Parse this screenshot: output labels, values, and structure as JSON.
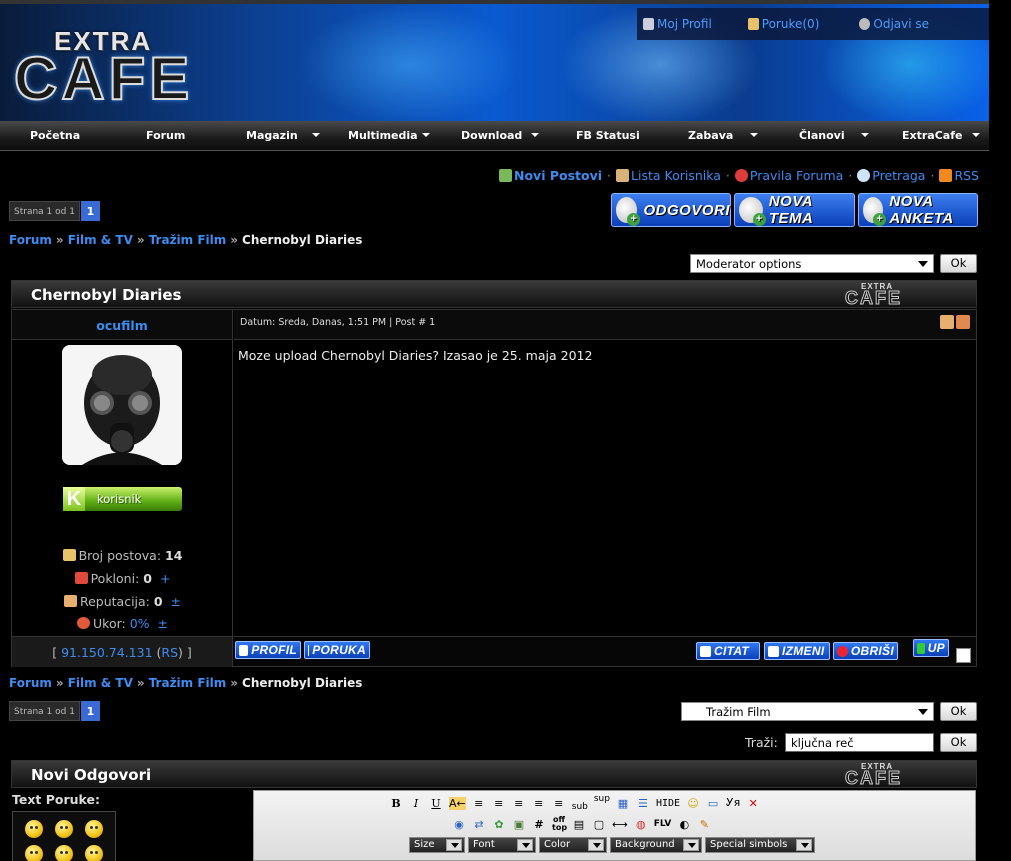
{
  "header": {
    "logo_top": "EXTRA",
    "logo_main": "CAFE",
    "user_links": [
      {
        "label": "Moj Profil",
        "icon": "user-icon"
      },
      {
        "label": "Poruke(0)",
        "icon": "pencil-icon"
      },
      {
        "label": "Odjavi se",
        "icon": "logout-icon"
      }
    ]
  },
  "nav": [
    {
      "label": "Početna",
      "dropdown": false
    },
    {
      "label": "Forum",
      "dropdown": false
    },
    {
      "label": "Magazin",
      "dropdown": true
    },
    {
      "label": "Multimedia",
      "dropdown": true
    },
    {
      "label": "Download",
      "dropdown": true
    },
    {
      "label": "FB Statusi",
      "dropdown": false
    },
    {
      "label": "Zabava",
      "dropdown": true
    },
    {
      "label": "Članovi",
      "dropdown": true
    },
    {
      "label": "ExtraCafe",
      "dropdown": true
    }
  ],
  "quick_links": [
    {
      "label": "Novi Postovi",
      "bold": true,
      "icon": "new-posts-icon"
    },
    {
      "label": "Lista Korisnika",
      "bold": false,
      "icon": "members-icon"
    },
    {
      "label": "Pravila Foruma",
      "bold": false,
      "icon": "rules-icon"
    },
    {
      "label": "Pretraga",
      "bold": false,
      "icon": "search-icon"
    },
    {
      "label": "RSS",
      "bold": false,
      "icon": "rss-icon"
    }
  ],
  "pagination": {
    "label": "Strana 1 od 1",
    "current": "1"
  },
  "action_buttons": [
    "ODGOVORI",
    "NOVA TEMA",
    "NOVA ANKETA"
  ],
  "breadcrumb": [
    {
      "label": "Forum",
      "link": true
    },
    {
      "label": "Film & TV",
      "link": true
    },
    {
      "label": "Tražim Film",
      "link": true
    },
    {
      "label": "Chernobyl Diaries",
      "link": false
    }
  ],
  "moderator_select": "Moderator options",
  "ok_label": "Ok",
  "topic": {
    "title": "Chernobyl Diaries",
    "box_logo_top": "EXTRA",
    "box_logo_main": "CAFE"
  },
  "post": {
    "author": "ocufilm",
    "meta": "Datum: Sreda, Danas, 1:51 PM | Post # 1",
    "body": "Moze upload Chernobyl Diaries? Izasao je 25. maja 2012",
    "rank": {
      "letter": "K",
      "label": "korisnik"
    },
    "stats": [
      {
        "label": "Broj postova:",
        "value": "14",
        "extra": "",
        "icon": "posts-icon"
      },
      {
        "label": "Pokloni:",
        "value": "0",
        "extra": "+",
        "icon": "gift-icon"
      },
      {
        "label": "Reputacija:",
        "value": "0",
        "extra": "±",
        "icon": "thumb-icon"
      },
      {
        "label": "Ukor:",
        "value": "0%",
        "extra": "±",
        "icon": "warning-icon"
      }
    ],
    "ip": "91.150.74.131",
    "country": "RS",
    "buttons_left": [
      "PROFIL",
      "PORUKA"
    ],
    "buttons_right": [
      "CITAT",
      "IZMENI",
      "OBRIŠI",
      "UP"
    ]
  },
  "jump_select": "Tražim Film",
  "search": {
    "label": "Traži:",
    "value": "ključna reč"
  },
  "reply": {
    "title": "Novi Odgovori",
    "text_label": "Text Poruke:",
    "toolbar_row1": [
      "B",
      "I",
      "U",
      "A←",
      "≡",
      "≡",
      "≡",
      "≡",
      "≡",
      "sub",
      "sup",
      "▦",
      "☰",
      "HIDE",
      "☺",
      "▭",
      "Ꭹя",
      "✕"
    ],
    "toolbar_row2": [
      "◉",
      "⇄",
      "✿",
      "▣",
      "#",
      "off top",
      "▤",
      "▢",
      "⟷",
      "◍",
      "FLV",
      "◐",
      "✎"
    ],
    "dropdowns": [
      "Size",
      "Font",
      "Color",
      "Background",
      "Special simbols"
    ]
  },
  "colors": {
    "accent": "#3d8cf0",
    "header_blue": "#0a5ad0",
    "button_blue": "#1a5ee0"
  }
}
